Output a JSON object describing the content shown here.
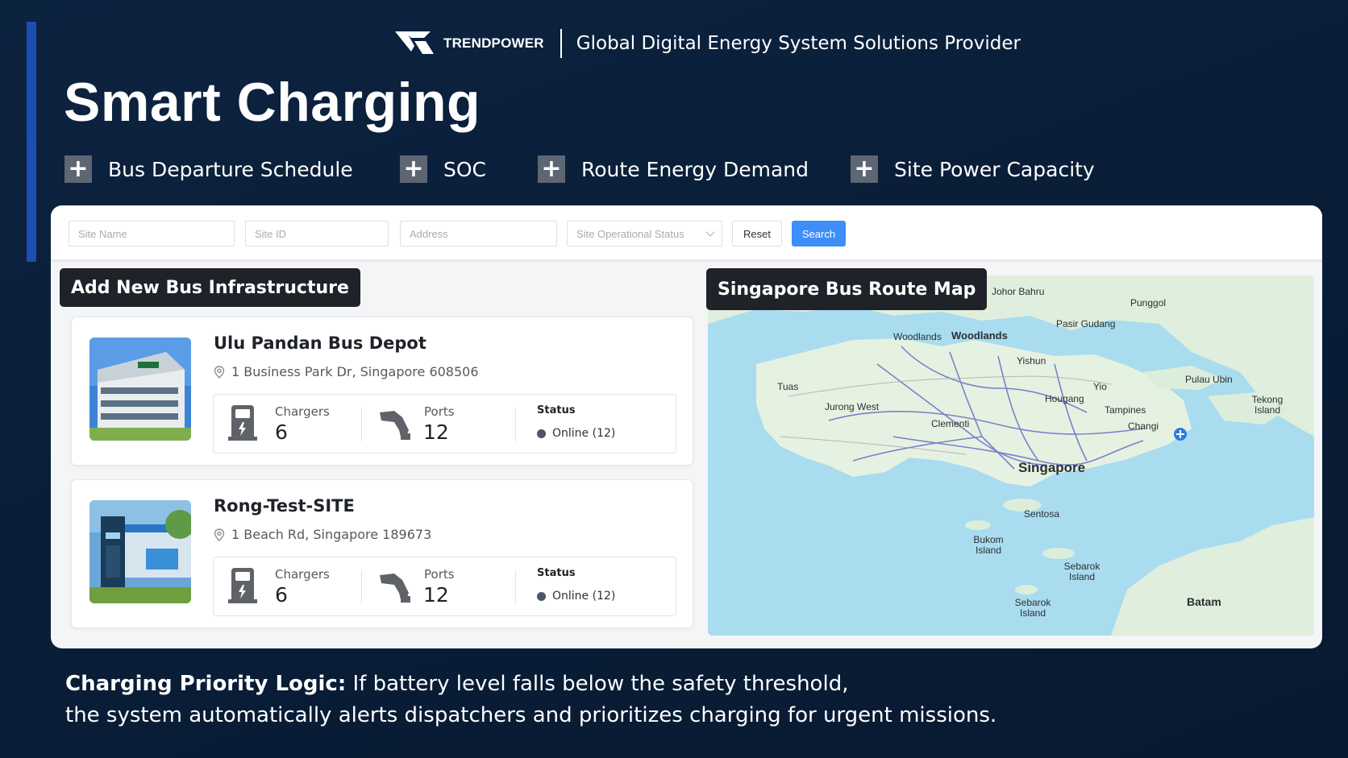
{
  "brand": {
    "name": "TRENDPOWER",
    "tagline": "Global Digital Energy System Solutions Provider"
  },
  "page_title": "Smart Charging",
  "features": [
    {
      "label": "Bus Departure Schedule",
      "icon": "plus-icon"
    },
    {
      "label": "SOC",
      "icon": "plus-icon"
    },
    {
      "label": "Route Energy Demand",
      "icon": "plus-icon"
    },
    {
      "label": "Site Power Capacity",
      "icon": "plus-icon"
    }
  ],
  "filters": {
    "site_name_placeholder": "Site Name",
    "site_id_placeholder": "Site ID",
    "address_placeholder": "Address",
    "status_placeholder": "Site Operational Status",
    "reset_label": "Reset",
    "search_label": "Search"
  },
  "infrastructure": {
    "section_title": "Add New Bus Infrastructure",
    "sites": [
      {
        "name": "Ulu Pandan Bus Depot",
        "address": "1 Business Park Dr, Singapore 608506",
        "chargers_label": "Chargers",
        "chargers": "6",
        "ports_label": "Ports",
        "ports": "12",
        "status_label": "Status",
        "status": "Online (12)"
      },
      {
        "name": "Rong-Test-SITE",
        "address": "1 Beach Rd, Singapore 189673",
        "chargers_label": "Chargers",
        "chargers": "6",
        "ports_label": "Ports",
        "ports": "12",
        "status_label": "Status",
        "status": "Online (12)"
      }
    ]
  },
  "map": {
    "title": "Singapore Bus Route Map",
    "labels": {
      "johor_bahru": "Johor Bahru",
      "punggol": "Punggol",
      "woodlands": "Woodlands",
      "woodlands2": "Woodlands",
      "pasir_gudang": "Pasir Gudang",
      "yishun": "Yishun",
      "pulau_ubin": "Pulau Ubin",
      "tuas": "Tuas",
      "hougang": "Hougang",
      "yio": "Yio",
      "tekong": "Tekong Island",
      "jurong_west": "Jurong West",
      "tampines": "Tampines",
      "clementi": "Clementi",
      "changi": "Changi",
      "singapore": "Singapore",
      "sentosa": "Sentosa",
      "bukom": "Bukom Island",
      "sebarok": "Sebarok Island",
      "sebarok2": "Sebarok Island",
      "batam": "Batam"
    }
  },
  "footer": {
    "lead": "Charging Priority Logic:",
    "line1": "If battery level falls below the safety threshold,",
    "line2": "the system automatically alerts dispatchers and prioritizes charging for urgent missions."
  },
  "colors": {
    "background": "#0a1e38",
    "accent": "#1a4fb4",
    "search_button": "#3d8ef8",
    "plus_box": "#5d6672"
  }
}
